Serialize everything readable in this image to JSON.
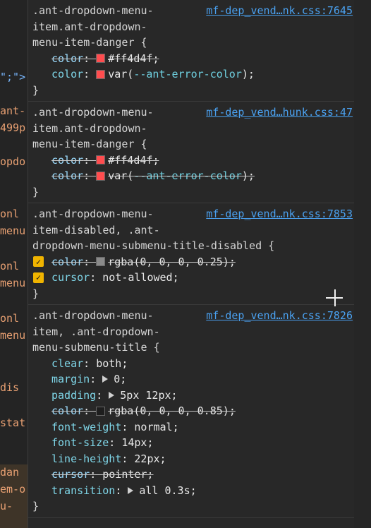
{
  "gutter": {
    "fragments": [
      {
        "text": "\";\">",
        "color": "#79b8ff"
      },
      {
        "text": "ant-"
      },
      {
        "text": "499p"
      },
      {
        "text": "opdo"
      },
      {
        "text": "onl"
      },
      {
        "text": "menu"
      },
      {
        "text": "onl"
      },
      {
        "text": "menu"
      },
      {
        "text": "onl"
      },
      {
        "text": "menu"
      },
      {
        "text": "dis"
      },
      {
        "text": "stat"
      },
      {
        "text": "dan"
      },
      {
        "text": "em-o"
      },
      {
        "text": "u-"
      }
    ]
  },
  "rules": [
    {
      "selector": ".ant-dropdown-menu-\nitem.ant-dropdown-\nmenu-item-danger {",
      "source": "mf-dep_vend…nk.css:7645",
      "declarations": [
        {
          "prop": "color",
          "value": "#ff4d4f",
          "swatch": "#ff4d4f",
          "struck": true
        },
        {
          "prop": "color",
          "value": "var(--ant-error-color)",
          "swatch": "#ff4d4f",
          "struck": false,
          "var": true
        }
      ]
    },
    {
      "selector": ".ant-dropdown-menu-\nitem.ant-dropdown-\nmenu-item-danger {",
      "source": "mf-dep_vend…hunk.css:47",
      "declarations": [
        {
          "prop": "color",
          "value": "#ff4d4f",
          "swatch": "#ff4d4f",
          "struck": true
        },
        {
          "prop": "color",
          "value": "var(--ant-error-color)",
          "swatch": "#ff4d4f",
          "struck": true,
          "var": true
        }
      ]
    },
    {
      "selector": ".ant-dropdown-menu-\nitem-disabled, .ant-\ndropdown-menu-submenu-title-disabled {",
      "source": "mf-dep_vend…nk.css:7853",
      "declarations": [
        {
          "prop": "color",
          "value": "rgba(0, 0, 0, 0.25)",
          "swatch": "#8a8a8a",
          "struck": true,
          "checkbox": true
        },
        {
          "prop": "cursor",
          "value": "not-allowed",
          "struck": false,
          "checkbox": true
        }
      ]
    },
    {
      "selector": ".ant-dropdown-menu-\nitem, .ant-dropdown-\nmenu-submenu-title {",
      "source": "mf-dep_vend…nk.css:7826",
      "declarations": [
        {
          "prop": "clear",
          "value": "both",
          "struck": false
        },
        {
          "prop": "margin",
          "value": "0",
          "struck": false,
          "expand": true
        },
        {
          "prop": "padding",
          "value": "5px 12px",
          "struck": false,
          "expand": true
        },
        {
          "prop": "color",
          "value": "rgba(0, 0, 0, 0.85)",
          "swatch": "#1e1e1e",
          "struck": true
        },
        {
          "prop": "font-weight",
          "value": "normal",
          "struck": false
        },
        {
          "prop": "font-size",
          "value": "14px",
          "struck": false
        },
        {
          "prop": "line-height",
          "value": "22px",
          "struck": false
        },
        {
          "prop": "cursor",
          "value": "pointer",
          "struck": true
        },
        {
          "prop": "transition",
          "value": "all 0.3s",
          "struck": false,
          "expand": true
        }
      ]
    }
  ],
  "closing_brace": "}"
}
